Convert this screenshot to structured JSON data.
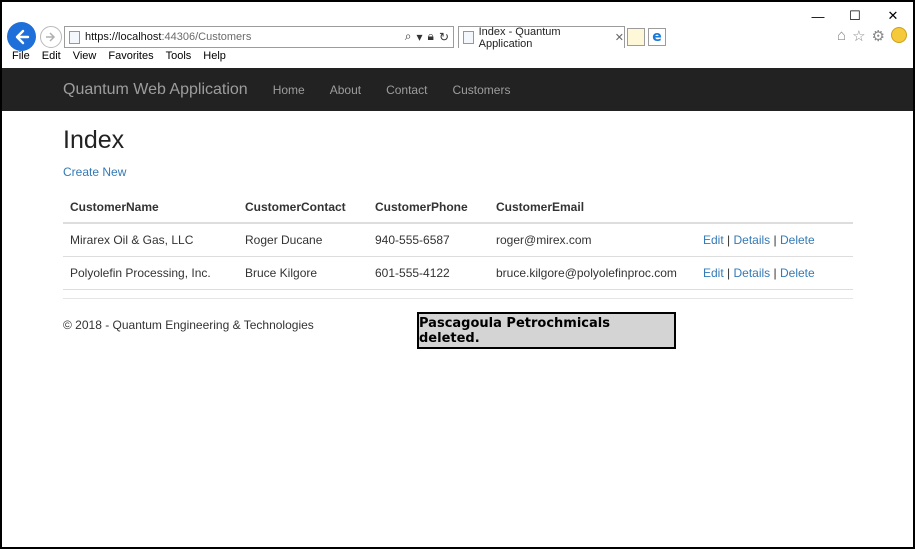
{
  "browser": {
    "url_host": "https://localhost",
    "url_rest": ":44306/Customers",
    "tab_title": "Index - Quantum Application",
    "menu": [
      "File",
      "Edit",
      "View",
      "Favorites",
      "Tools",
      "Help"
    ]
  },
  "navbar": {
    "brand": "Quantum Web Application",
    "links": [
      "Home",
      "About",
      "Contact",
      "Customers"
    ]
  },
  "main": {
    "title": "Index",
    "create_new": "Create New",
    "table": {
      "headers": [
        "CustomerName",
        "CustomerContact",
        "CustomerPhone",
        "CustomerEmail"
      ],
      "rows": [
        [
          "Mirarex Oil & Gas, LLC",
          "Roger Ducane",
          "940-555-6587",
          "roger@mirex.com"
        ],
        [
          "Polyolefin Processing, Inc.",
          "Bruce Kilgore",
          "601-555-4122",
          "bruce.kilgore@polyolefinproc.com"
        ]
      ],
      "actions": [
        "Edit",
        "Details",
        "Delete"
      ],
      "separator": "|"
    }
  },
  "footer": {
    "text": "© 2018 - Quantum Engineering & Technologies"
  },
  "toast": {
    "message": "Pascagoula Petrochmicals deleted."
  }
}
